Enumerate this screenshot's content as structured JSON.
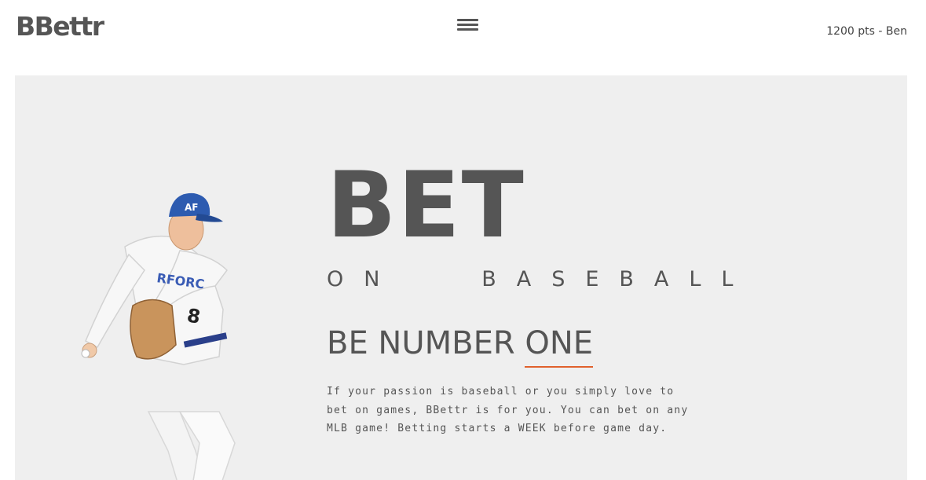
{
  "header": {
    "logo": "BBettr",
    "menu_icon": "hamburger-menu-icon",
    "user_points": "1200 pts - Ben"
  },
  "hero": {
    "headline": "BET",
    "subheadline": "ON   BASEBALL",
    "tagline_prefix": "BE NUMBER ",
    "tagline_accent": "ONE",
    "description": "If your passion is baseball or you simply love to bet on games, BBettr is for you. You can bet on any MLB game! Betting starts a WEEK before game day.",
    "image": "baseball-pitcher-image",
    "cap_lettering": "AF",
    "jersey_number": "8"
  },
  "colors": {
    "background": "#ffffff",
    "hero_background": "#efefef",
    "text": "#555555",
    "accent": "#e0612c",
    "cap": "#2d5bb0"
  }
}
